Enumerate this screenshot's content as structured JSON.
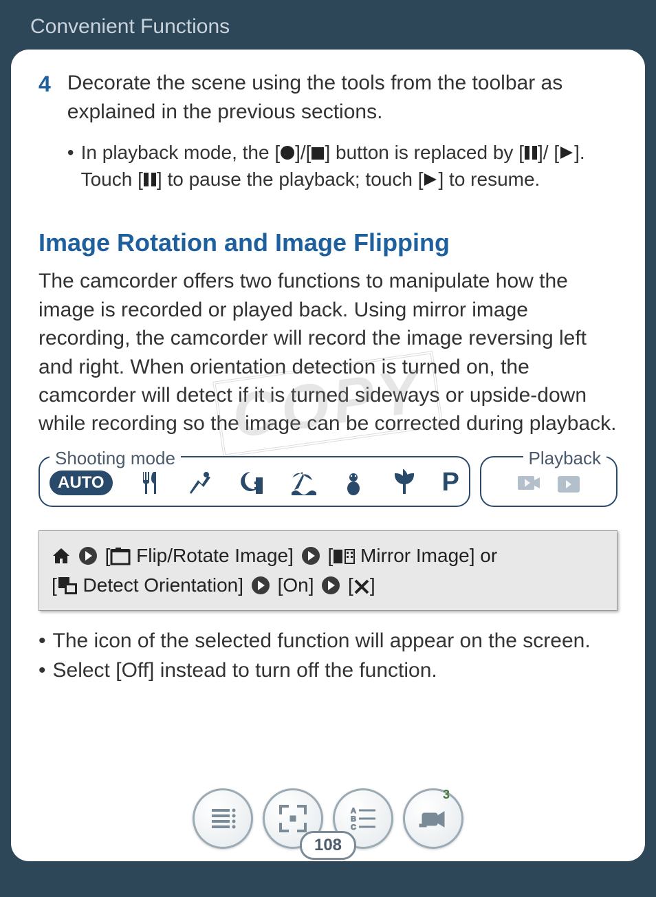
{
  "header": {
    "title": "Convenient Functions"
  },
  "step": {
    "number": "4",
    "text": "Decorate the scene using the tools from the toolbar as explained in the previous sections.",
    "bullet_prefix": "In playback mode, the [",
    "bullet_mid1": "]/[",
    "bullet_mid2": "] button is replaced by [",
    "bullet_mid3": "]/ [",
    "bullet_mid4": "]. Touch [",
    "bullet_mid5": "] to pause the playback; touch [",
    "bullet_mid6": "] to resume."
  },
  "section": {
    "heading": "Image Rotation and Image Flipping",
    "paragraph": "The camcorder offers two functions to manipulate how the image is recorded or played back. Using mirror image recording, the camcorder will record the image reversing left and right. When orientation detection is turned on, the camcorder will detect if it is turned sideways or upside-down while recording so the image can be corrected during playback."
  },
  "watermark": "COPY",
  "modes": {
    "shoot_label": "Shooting mode",
    "play_label": "Playback",
    "auto": "AUTO",
    "p": "P"
  },
  "proc": {
    "flip_label": " Flip/Rotate Image] ",
    "mirror_label": " Mirror Image] or",
    "detect_label": " Detect Orientation] ",
    "on_label": " [On] ",
    "open_bracket": " [",
    "close_bracket": "]"
  },
  "notes": {
    "n1": "The icon of the selected function will appear on the screen.",
    "n2": "Select [Off] instead to turn off the function."
  },
  "footer": {
    "page_number": "108",
    "badge": "3"
  }
}
